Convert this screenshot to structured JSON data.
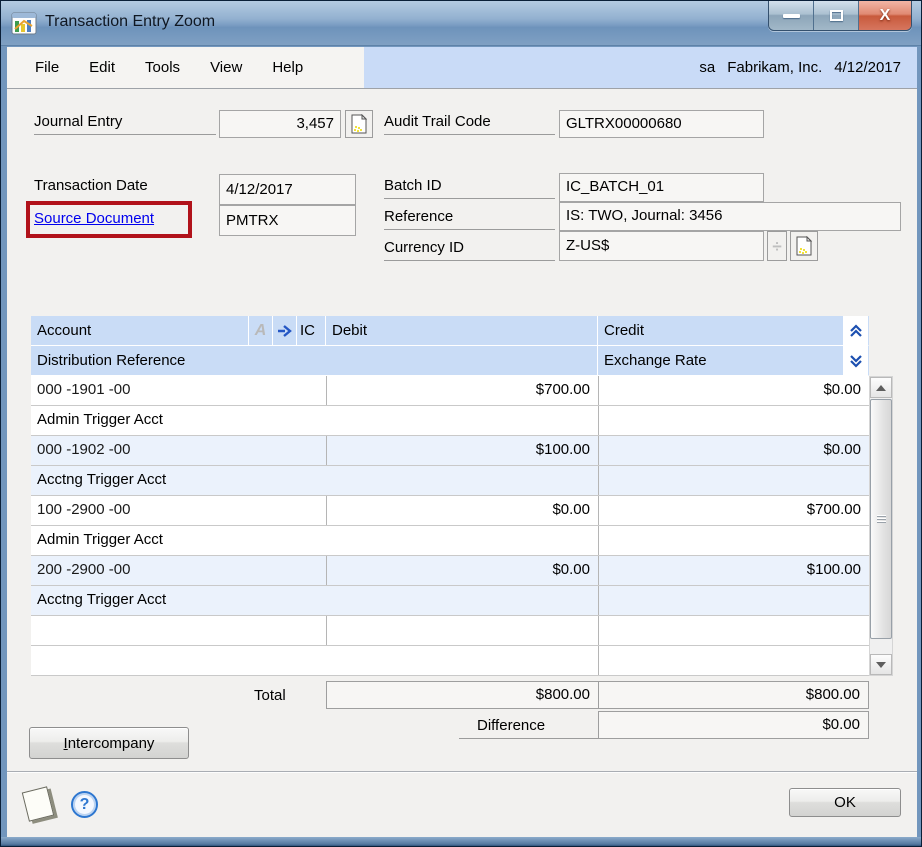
{
  "window": {
    "title": "Transaction Entry Zoom"
  },
  "menu": {
    "items": [
      "File",
      "Edit",
      "Tools",
      "View",
      "Help"
    ],
    "user": "sa",
    "company": "Fabrikam, Inc.",
    "date": "4/12/2017"
  },
  "fields": {
    "journal_entry": {
      "label": "Journal Entry",
      "value": "3,457"
    },
    "audit_trail_code": {
      "label": "Audit Trail Code",
      "value": "GLTRX00000680"
    },
    "transaction_date": {
      "label": "Transaction Date",
      "value": "4/12/2017"
    },
    "source_document": {
      "label": "Source Document",
      "value": "PMTRX"
    },
    "batch_id": {
      "label": "Batch ID",
      "value": "IC_BATCH_01"
    },
    "reference": {
      "label": "Reference",
      "value": "IS: TWO, Journal: 3456"
    },
    "currency_id": {
      "label": "Currency ID",
      "value": "Z-US$"
    }
  },
  "grid": {
    "headers": {
      "account": "Account",
      "ic": "IC",
      "debit": "Debit",
      "credit": "Credit",
      "distribution_reference": "Distribution Reference",
      "exchange_rate": "Exchange Rate"
    },
    "rows": [
      {
        "account": "000 -1901 -00",
        "debit": "$700.00",
        "credit": "$0.00",
        "distribution_reference": "Admin Trigger Acct",
        "exchange_rate": ""
      },
      {
        "account": "000 -1902 -00",
        "debit": "$100.00",
        "credit": "$0.00",
        "distribution_reference": "Acctng Trigger Acct",
        "exchange_rate": ""
      },
      {
        "account": "100 -2900 -00",
        "debit": "$0.00",
        "credit": "$700.00",
        "distribution_reference": "Admin Trigger Acct",
        "exchange_rate": ""
      },
      {
        "account": "200 -2900 -00",
        "debit": "$0.00",
        "credit": "$100.00",
        "distribution_reference": "Acctng Trigger Acct",
        "exchange_rate": ""
      },
      {
        "account": "",
        "debit": "",
        "credit": "",
        "distribution_reference": "",
        "exchange_rate": ""
      }
    ]
  },
  "totals": {
    "total_label": "Total",
    "total_debit": "$800.00",
    "total_credit": "$800.00",
    "difference_label": "Difference",
    "difference_value": "$0.00"
  },
  "buttons": {
    "intercompany": "Intercompany",
    "ok": "OK"
  },
  "icons": {
    "close_glyph": "X",
    "help_glyph": "?",
    "currency_expand_glyph": "÷",
    "alias_glyph": "A"
  },
  "colors": {
    "titlebar_top": "#B4CBE2",
    "status_bar_bg": "#C9DBF7",
    "header_bg": "#C9DCF6",
    "row_alt_bg": "#EBF2FC",
    "annotation_red": "#B1121A",
    "link_blue": "#0000EE"
  }
}
